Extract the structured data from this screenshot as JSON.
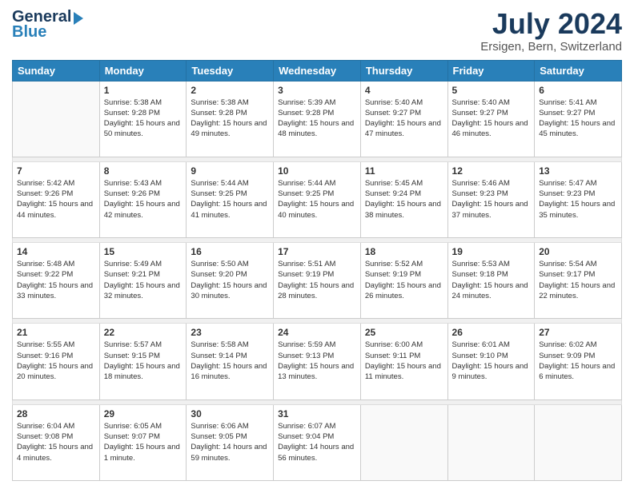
{
  "header": {
    "logo_line1": "General",
    "logo_line2": "Blue",
    "title": "July 2024",
    "location": "Ersigen, Bern, Switzerland"
  },
  "weekdays": [
    "Sunday",
    "Monday",
    "Tuesday",
    "Wednesday",
    "Thursday",
    "Friday",
    "Saturday"
  ],
  "weeks": [
    [
      {
        "day": "",
        "empty": true
      },
      {
        "day": "1",
        "sunrise": "5:38 AM",
        "sunset": "9:28 PM",
        "daylight": "15 hours and 50 minutes."
      },
      {
        "day": "2",
        "sunrise": "5:38 AM",
        "sunset": "9:28 PM",
        "daylight": "15 hours and 49 minutes."
      },
      {
        "day": "3",
        "sunrise": "5:39 AM",
        "sunset": "9:28 PM",
        "daylight": "15 hours and 48 minutes."
      },
      {
        "day": "4",
        "sunrise": "5:40 AM",
        "sunset": "9:27 PM",
        "daylight": "15 hours and 47 minutes."
      },
      {
        "day": "5",
        "sunrise": "5:40 AM",
        "sunset": "9:27 PM",
        "daylight": "15 hours and 46 minutes."
      },
      {
        "day": "6",
        "sunrise": "5:41 AM",
        "sunset": "9:27 PM",
        "daylight": "15 hours and 45 minutes."
      }
    ],
    [
      {
        "day": "7",
        "sunrise": "5:42 AM",
        "sunset": "9:26 PM",
        "daylight": "15 hours and 44 minutes."
      },
      {
        "day": "8",
        "sunrise": "5:43 AM",
        "sunset": "9:26 PM",
        "daylight": "15 hours and 42 minutes."
      },
      {
        "day": "9",
        "sunrise": "5:44 AM",
        "sunset": "9:25 PM",
        "daylight": "15 hours and 41 minutes."
      },
      {
        "day": "10",
        "sunrise": "5:44 AM",
        "sunset": "9:25 PM",
        "daylight": "15 hours and 40 minutes."
      },
      {
        "day": "11",
        "sunrise": "5:45 AM",
        "sunset": "9:24 PM",
        "daylight": "15 hours and 38 minutes."
      },
      {
        "day": "12",
        "sunrise": "5:46 AM",
        "sunset": "9:23 PM",
        "daylight": "15 hours and 37 minutes."
      },
      {
        "day": "13",
        "sunrise": "5:47 AM",
        "sunset": "9:23 PM",
        "daylight": "15 hours and 35 minutes."
      }
    ],
    [
      {
        "day": "14",
        "sunrise": "5:48 AM",
        "sunset": "9:22 PM",
        "daylight": "15 hours and 33 minutes."
      },
      {
        "day": "15",
        "sunrise": "5:49 AM",
        "sunset": "9:21 PM",
        "daylight": "15 hours and 32 minutes."
      },
      {
        "day": "16",
        "sunrise": "5:50 AM",
        "sunset": "9:20 PM",
        "daylight": "15 hours and 30 minutes."
      },
      {
        "day": "17",
        "sunrise": "5:51 AM",
        "sunset": "9:19 PM",
        "daylight": "15 hours and 28 minutes."
      },
      {
        "day": "18",
        "sunrise": "5:52 AM",
        "sunset": "9:19 PM",
        "daylight": "15 hours and 26 minutes."
      },
      {
        "day": "19",
        "sunrise": "5:53 AM",
        "sunset": "9:18 PM",
        "daylight": "15 hours and 24 minutes."
      },
      {
        "day": "20",
        "sunrise": "5:54 AM",
        "sunset": "9:17 PM",
        "daylight": "15 hours and 22 minutes."
      }
    ],
    [
      {
        "day": "21",
        "sunrise": "5:55 AM",
        "sunset": "9:16 PM",
        "daylight": "15 hours and 20 minutes."
      },
      {
        "day": "22",
        "sunrise": "5:57 AM",
        "sunset": "9:15 PM",
        "daylight": "15 hours and 18 minutes."
      },
      {
        "day": "23",
        "sunrise": "5:58 AM",
        "sunset": "9:14 PM",
        "daylight": "15 hours and 16 minutes."
      },
      {
        "day": "24",
        "sunrise": "5:59 AM",
        "sunset": "9:13 PM",
        "daylight": "15 hours and 13 minutes."
      },
      {
        "day": "25",
        "sunrise": "6:00 AM",
        "sunset": "9:11 PM",
        "daylight": "15 hours and 11 minutes."
      },
      {
        "day": "26",
        "sunrise": "6:01 AM",
        "sunset": "9:10 PM",
        "daylight": "15 hours and 9 minutes."
      },
      {
        "day": "27",
        "sunrise": "6:02 AM",
        "sunset": "9:09 PM",
        "daylight": "15 hours and 6 minutes."
      }
    ],
    [
      {
        "day": "28",
        "sunrise": "6:04 AM",
        "sunset": "9:08 PM",
        "daylight": "15 hours and 4 minutes."
      },
      {
        "day": "29",
        "sunrise": "6:05 AM",
        "sunset": "9:07 PM",
        "daylight": "15 hours and 1 minute."
      },
      {
        "day": "30",
        "sunrise": "6:06 AM",
        "sunset": "9:05 PM",
        "daylight": "14 hours and 59 minutes."
      },
      {
        "day": "31",
        "sunrise": "6:07 AM",
        "sunset": "9:04 PM",
        "daylight": "14 hours and 56 minutes."
      },
      {
        "day": "",
        "empty": true
      },
      {
        "day": "",
        "empty": true
      },
      {
        "day": "",
        "empty": true
      }
    ]
  ]
}
